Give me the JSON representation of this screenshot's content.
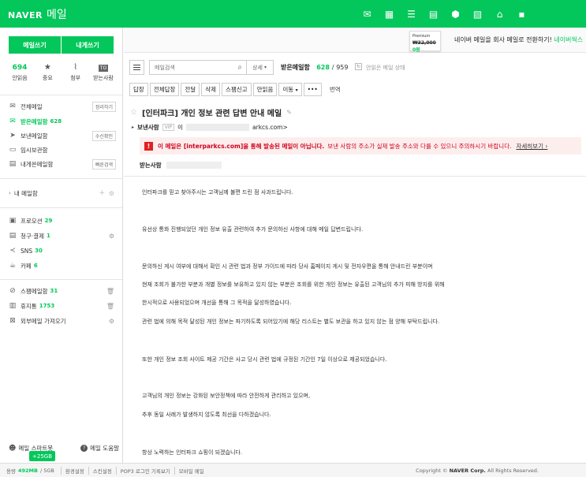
{
  "header": {
    "brand": "NAVER",
    "product": "메일",
    "icons": [
      "mail-envelope-icon",
      "calendar-icon",
      "contacts-list-icon",
      "memo-icon",
      "mybox-icon",
      "office-icon",
      "blog-icon",
      "more-apps-icon"
    ]
  },
  "sidebar": {
    "compose_label": "메일쓰기",
    "self_compose_label": "내게쓰기",
    "quick": [
      {
        "value": "694",
        "label": "안읽음"
      },
      {
        "icon": "star-icon",
        "label": "중요"
      },
      {
        "icon": "paperclip-icon",
        "label": "첨부"
      },
      {
        "badge": "TO",
        "label": "받는사람"
      }
    ],
    "mailboxes": [
      {
        "label": "전체메일",
        "action": "정리하기",
        "icon": "all-mail-icon"
      },
      {
        "label": "받은메일함",
        "count": "628",
        "icon": "inbox-icon"
      },
      {
        "label": "보낸메일함",
        "action": "수신확인",
        "icon": "sent-icon"
      },
      {
        "label": "임시보관함",
        "icon": "draft-icon"
      },
      {
        "label": "내게쓴메일함",
        "action": "빠른검색",
        "icon": "self-mail-icon"
      }
    ],
    "my_mailboxes_label": "내 메일함",
    "categories": [
      {
        "label": "프로모션",
        "count": "29",
        "icon": "shopping-bag-icon"
      },
      {
        "label": "청구·결제",
        "count": "1",
        "icon": "receipt-icon"
      },
      {
        "label": "SNS",
        "count": "30",
        "icon": "share-icon"
      },
      {
        "label": "카페",
        "count": "6",
        "icon": "cafe-icon"
      }
    ],
    "system": [
      {
        "label": "스팸메일함",
        "count": "31",
        "icon": "spam-icon"
      },
      {
        "label": "휴지통",
        "count": "1753",
        "icon": "trash-icon"
      },
      {
        "label": "외부메일 가져오기",
        "icon": "external-mail-icon"
      }
    ],
    "footer_left": "메일 스마트봇",
    "footer_right": "메일 도움말",
    "storage_badge": "+25GB"
  },
  "ad": {
    "card_top": "Premium",
    "card_price_strike": "₩32,000",
    "card_price_now": "0원",
    "text": "네이버 메일을 회사 메일로 전환하기!",
    "text_accent": "네이버웍스"
  },
  "toolbar": {
    "search_placeholder": "메일검색",
    "detail_label": "상세",
    "mailbox_name": "받은메일함",
    "unread_count": "628",
    "total_count": "959",
    "unread_only_label": "안읽은 메일 상태",
    "actions": [
      "답장",
      "전체답장",
      "전달",
      "삭제",
      "스팸신고",
      "안읽음",
      "이동",
      "•••"
    ],
    "translate_label": "번역"
  },
  "mail": {
    "subject": "[인터파크] 개인 정보 관련 답변 안내 메일",
    "sender_label": "보낸사람",
    "vip_badge": "VIP",
    "sender_name_prefix": "이",
    "sender_domain": "arkcs.com>",
    "warning_strong": "이 메일은 [interparkcs.com]을 통해 발송된 메일이 아닙니다.",
    "warning_normal": "보낸 사람의 주소가 실제 발송 주소와 다를 수 있으니 주의하시기 바랍니다.",
    "warning_more": "자세히보기 ›",
    "recipient_label": "받는사람",
    "body": [
      "인터파크를 믿고 찾아주시는 고객님께 불편 드린 점 사과드립니다.",
      "유선상 통화 진행되었던 개인 정보 유출 관련하여 추가 문의하신 사항에 대해 메일 답변드립니다.",
      "문의하신 게시 여부에 대해서 확인 시 관련 법과 정부 가이드에 따라 당사 홈페이지 게시 및 전자우편을 통해 안내드린 부분이며",
      "현재 조회가 불가한 부분과 개별 정보를 보유하고 있지 않는 부분은 조회를 위한 개인 정보는 유출된 고객님의 추가 피해 방지를 위해",
      "한시적으로 사용되었으며 개선을 통해 그 목적을 달성하였습니다.",
      "관련 법에 의해 목적 달성된 개인 정보는 파기하도록 되어있기에 해당 리스트는 별도 보관을 하고 있지 않는 점 양해 부탁드립니다.",
      "또한 개인 정보 조회 사이트 제공 기간은 사고 당시 관련 법에 규정된 기간인 7일 이상으로 제공되었습니다.",
      "고객님의 개인 정보는 강화된 보안정책에 따라 안전하게 관리하고 있으며,",
      "추후 동일 사례가 발생하지 않도록 최선을 다하겠습니다.",
      "항상 노력하는 인터파크 쇼핑이 되겠습니다."
    ]
  },
  "footer": {
    "usage_label": "용량",
    "usage_used": "492MB",
    "usage_total": "/ 5GB",
    "links": [
      "환경설정",
      "스킨설정",
      "POP3 로그인 기록보기",
      "모바일 메일"
    ],
    "copyright_prefix": "Copyright ©",
    "copyright_company": "NAVER Corp.",
    "copyright_suffix": "All Rights Reserved."
  },
  "colors": {
    "brand_green": "#03c75a",
    "warning_red": "#d0021b",
    "warning_bg": "#fdeeee"
  }
}
